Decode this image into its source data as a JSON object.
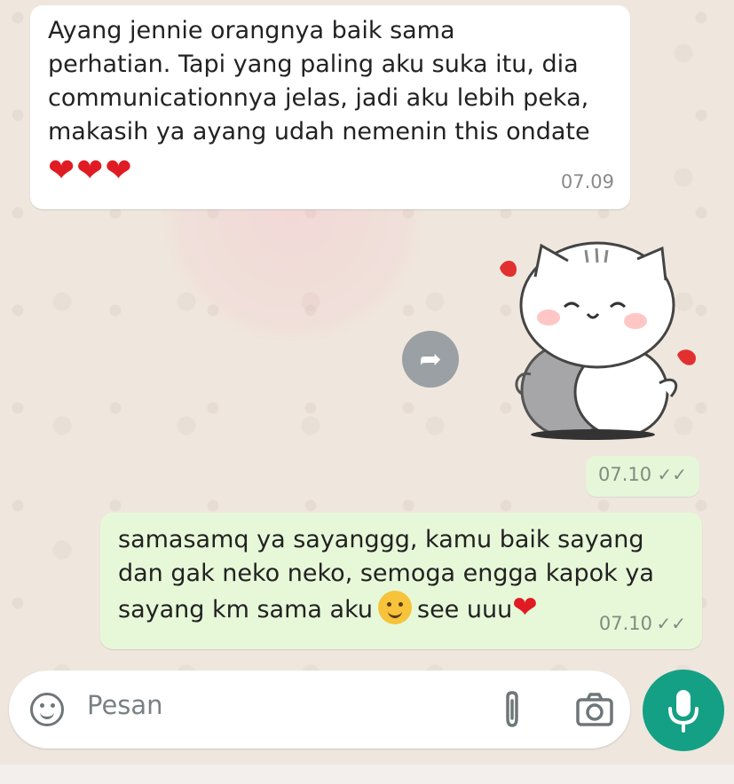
{
  "conversation": {
    "incoming_message": {
      "text": "Ayang jennie orangnya baik sama\nperhatian. Tapi yang paling aku suka itu, dia\ncommunicationnya jelas, jadi aku lebih peka,\nmakasih ya ayang udah nemenin this ondate",
      "hearts": "❤❤❤",
      "time": "07.09"
    },
    "sticker": {
      "icon": "cat-hug-sticker",
      "time": "07.10",
      "read_ticks": "✓✓"
    },
    "forward_icon": "forward-icon",
    "outgoing_message": {
      "line1": "samasamq ya sayanggg, kamu baik sayang",
      "line2": "dan gak neko neko, semoga engga kapok ya",
      "line3_prefix": "sayang km sama aku",
      "line3_suffix": "see uuu",
      "heart": "❤",
      "time": "07.10",
      "read_ticks": "✓✓"
    }
  },
  "composer": {
    "placeholder": "Pesan",
    "emoji_icon": "emoji-icon",
    "attach_icon": "paperclip-icon",
    "camera_icon": "camera-icon",
    "mic_icon": "mic-icon"
  },
  "colors": {
    "incoming_bubble": "#ffffff",
    "outgoing_bubble": "#e7f8d9",
    "accent": "#14a085",
    "heart": "#e01b24"
  }
}
